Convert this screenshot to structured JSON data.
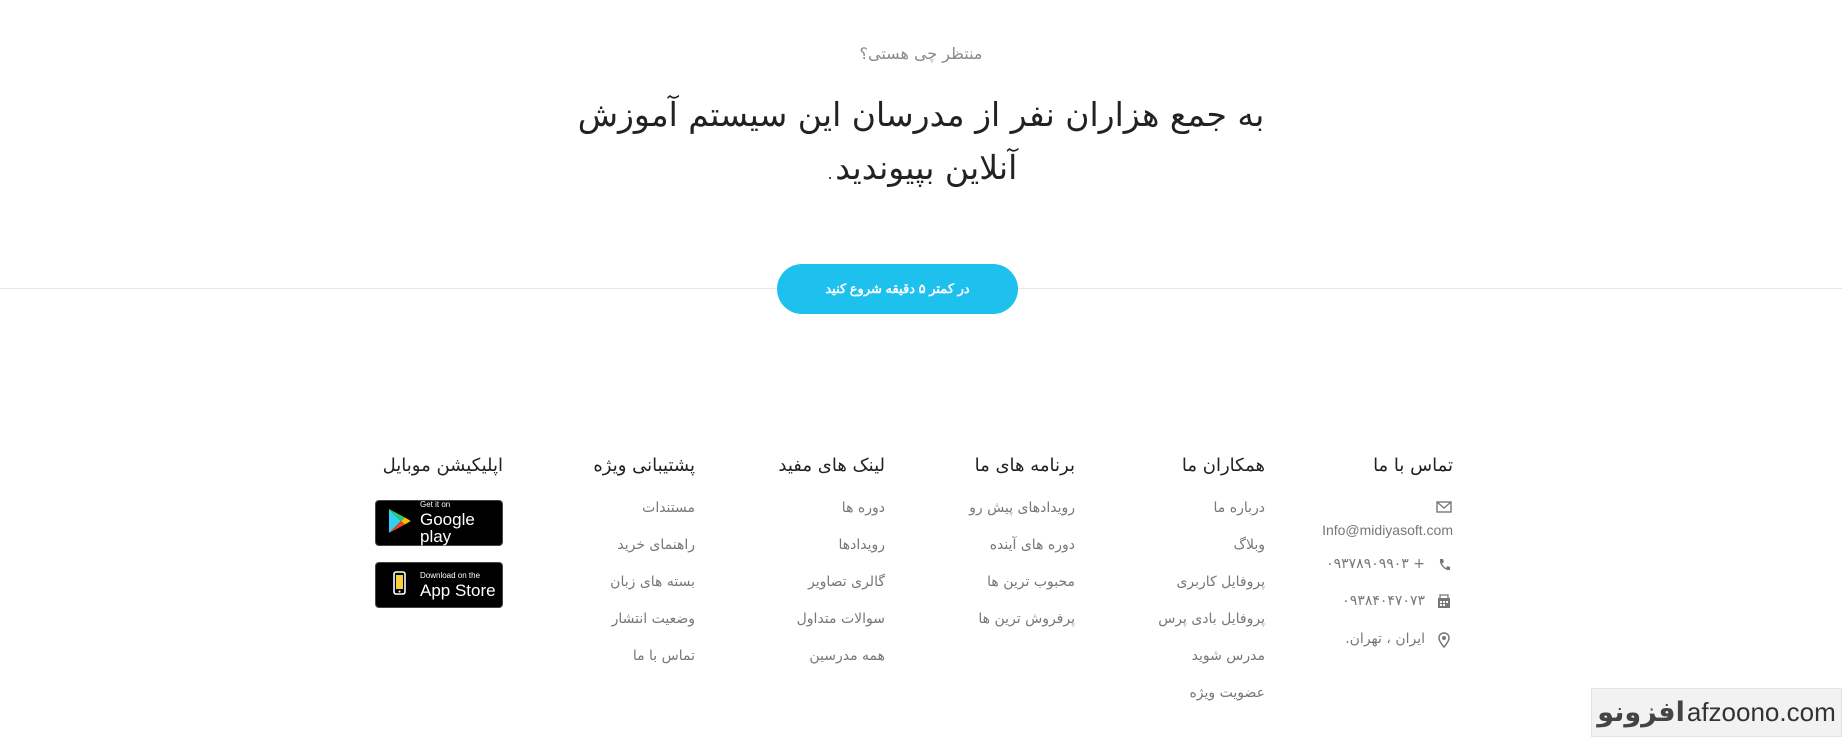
{
  "cta": {
    "eyebrow": "منتظر چی هستی؟",
    "heading": "به جمع هزاران نفر از مدرسان این سیستم آموزش آنلاین بپیوندید.",
    "button_label": "در کمتر ۵ دقیقه شروع کنید",
    "button_color": "#1ec0ee"
  },
  "footer": {
    "contact": {
      "title": "تماس با ما",
      "email": "Info@midiyasoft.com",
      "phone": "+ ۰۹۳۷۸۹۰۹۹۰۳",
      "fax": "۰۹۳۸۴۰۴۷۰۷۳",
      "address": "ایران ، تهران.",
      "icons": [
        "envelope-icon",
        "phone-icon",
        "fax-icon",
        "map-marker-icon"
      ]
    },
    "partners": {
      "title": "همکاران ما",
      "links": [
        "درباره ما",
        "وبلاگ",
        "پروفایل کاربری",
        "پروفایل بادی پرس",
        "مدرس شوید",
        "عضویت ویژه"
      ]
    },
    "programs": {
      "title": "برنامه های ما",
      "links": [
        "رویدادهای پیش رو",
        "دوره های آینده",
        "محبوب ترین ها",
        "پرفروش ترین ها"
      ]
    },
    "useful_links": {
      "title": "لینک های مفید",
      "links": [
        "دوره ها",
        "رویدادها",
        "گالری تصاویر",
        "سوالات متداول",
        "همه مدرسین"
      ]
    },
    "support": {
      "title": "پشتیبانی ویژه",
      "links": [
        "مستندات",
        "راهنمای خرید",
        "بسته های زبان",
        "وضعیت انتشار",
        "تماس با ما"
      ]
    },
    "mobile_app": {
      "title": "اپلیکیشن موبایل",
      "google_play": {
        "small": "Get it on",
        "big": "Google play"
      },
      "app_store": {
        "small": "Download on the",
        "big": "App Store"
      }
    }
  },
  "watermark": {
    "fa": "افزونو",
    "en": "afzoono.com"
  }
}
